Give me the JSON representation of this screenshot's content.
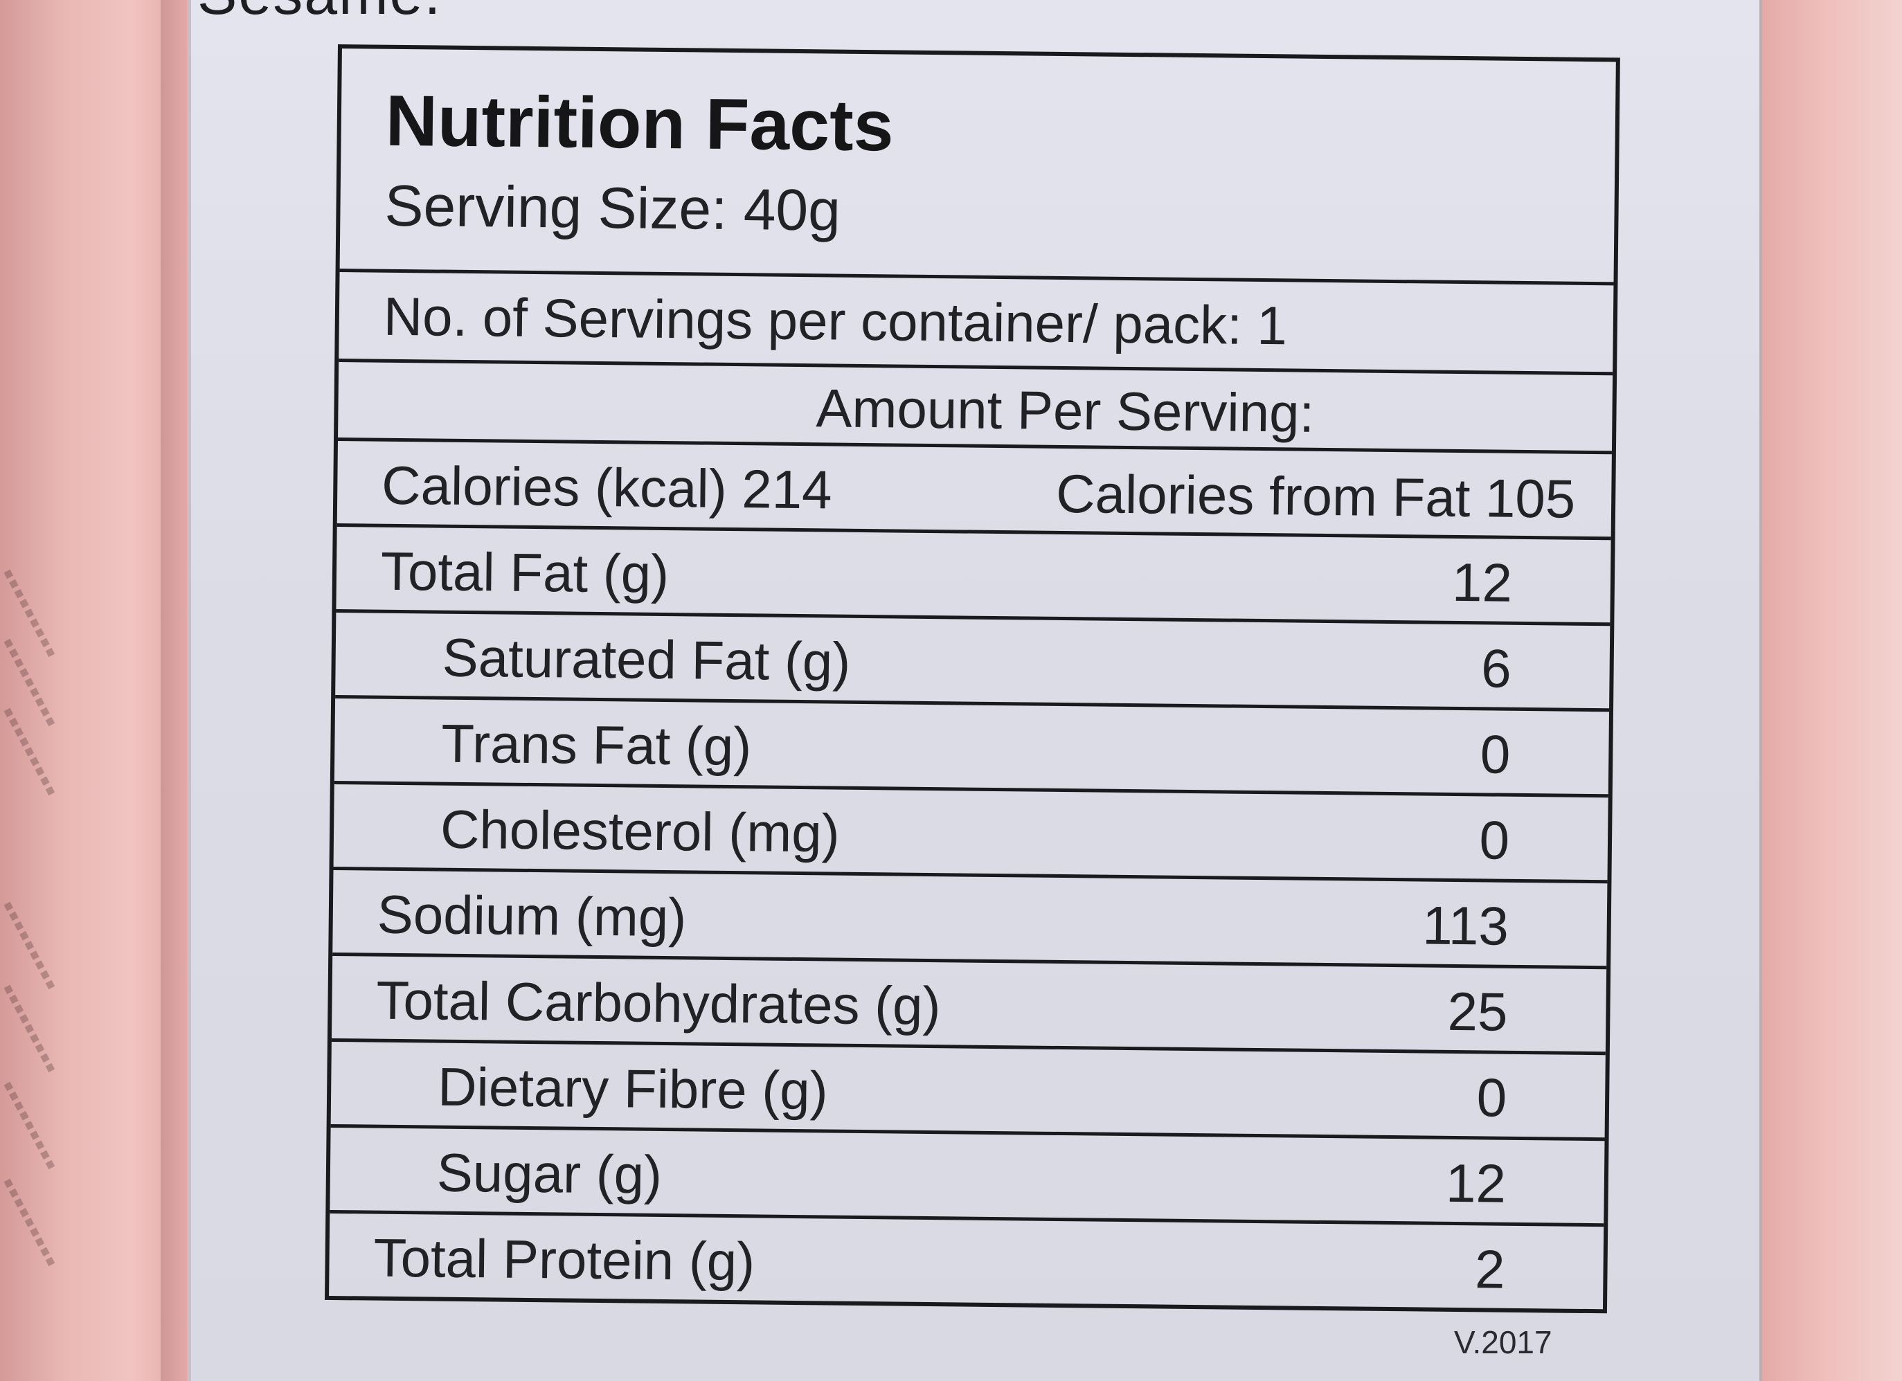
{
  "top_text": "Sesame.",
  "label": {
    "title": "Nutrition Facts",
    "serving_size": "Serving Size: 40g",
    "servings_per_container": "No. of Servings per container/ pack: 1",
    "amount_per_serving": "Amount Per Serving:",
    "calories": "Calories (kcal) 214",
    "calories_from_fat": "Calories from Fat 105",
    "rows": [
      {
        "label": "Total Fat (g)",
        "value": "12",
        "indent": false
      },
      {
        "label": "Saturated Fat (g)",
        "value": "6",
        "indent": true
      },
      {
        "label": "Trans Fat (g)",
        "value": "0",
        "indent": true
      },
      {
        "label": "Cholesterol (mg)",
        "value": "0",
        "indent": true
      },
      {
        "label": "Sodium (mg)",
        "value": "113",
        "indent": false
      },
      {
        "label": "Total Carbohydrates (g)",
        "value": "25",
        "indent": false
      },
      {
        "label": "Dietary Fibre (g)",
        "value": "0",
        "indent": true
      },
      {
        "label": "Sugar (g)",
        "value": "12",
        "indent": true
      },
      {
        "label": "Total Protein (g)",
        "value": "2",
        "indent": false
      }
    ],
    "version": "V.2017"
  },
  "colors": {
    "package_pink": "#e8b3b0",
    "label_background": "#dcdce6",
    "ink": "#1a1a1e"
  }
}
